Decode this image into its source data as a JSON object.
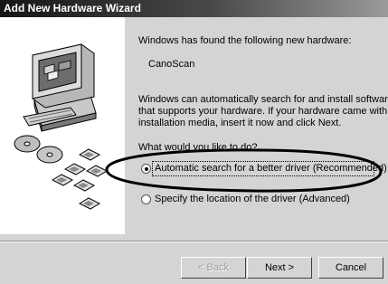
{
  "window": {
    "title": "Add New Hardware Wizard"
  },
  "main": {
    "intro": "Windows has found the following new hardware:",
    "device_name": "CanoScan",
    "description_lines": [
      "Windows can automatically search for and install software",
      "that supports your hardware. If your hardware came with",
      "installation media, insert it now and click Next."
    ],
    "question": "What would you like to do?",
    "options": [
      {
        "label": "Automatic search for a better driver (Recommended)",
        "selected": true
      },
      {
        "label": "Specify the location of the driver (Advanced)",
        "selected": false
      }
    ]
  },
  "buttons": {
    "back": "< Back",
    "next": "Next >",
    "cancel": "Cancel"
  },
  "icons": [
    "computer-icon",
    "floppy-disk-icon",
    "cd-rom-icon"
  ],
  "colors": {
    "dialog_bg": "#d4d4d4",
    "titlebar_start": "#151515",
    "titlebar_end": "#9a9a9a"
  }
}
